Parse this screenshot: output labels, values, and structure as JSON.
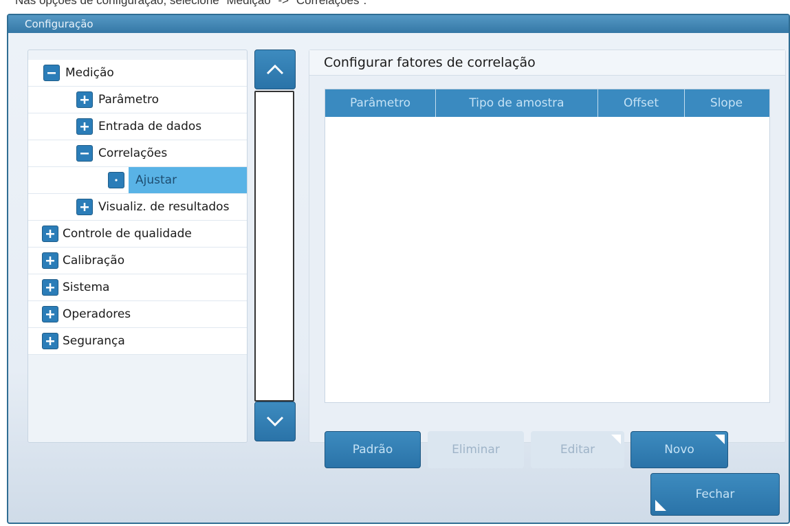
{
  "instruction": "Nas opções de configuração, selecione \"Medição\" -> \"Correlações\".",
  "window": {
    "title": "Configuração"
  },
  "tree": {
    "items": [
      {
        "label": "Medição",
        "icon": "minus-icon"
      },
      {
        "label": "Parâmetro",
        "icon": "plus-icon"
      },
      {
        "label": "Entrada de dados",
        "icon": "plus-icon"
      },
      {
        "label": "Correlações",
        "icon": "minus-icon"
      },
      {
        "label": "Ajustar",
        "icon": "dot-icon",
        "selected": true
      },
      {
        "label": "Visualiz. de resultados",
        "icon": "plus-icon"
      },
      {
        "label": "Controle de qualidade",
        "icon": "plus-icon"
      },
      {
        "label": "Calibração",
        "icon": "plus-icon"
      },
      {
        "label": "Sistema",
        "icon": "plus-icon"
      },
      {
        "label": "Operadores",
        "icon": "plus-icon"
      },
      {
        "label": "Segurança",
        "icon": "plus-icon"
      }
    ]
  },
  "scroll": {
    "up_icon": "chevron-up-icon",
    "down_icon": "chevron-down-icon"
  },
  "panel": {
    "title": "Configurar fatores de correlação",
    "columns": [
      "Parâmetro",
      "Tipo de amostra",
      "Offset",
      "Slope"
    ],
    "rows": []
  },
  "buttons": {
    "padrao": "Padrão",
    "eliminar": "Eliminar",
    "editar": "Editar",
    "novo": "Novo",
    "fechar": "Fechar"
  },
  "colors": {
    "accent": "#2b7db8",
    "selection": "#59b3e6",
    "header": "#3a8ac0",
    "disabled": "#dbe6f0"
  }
}
